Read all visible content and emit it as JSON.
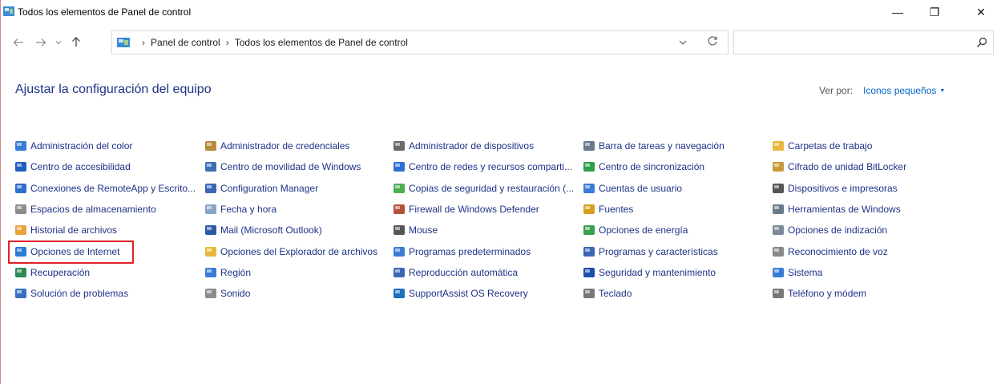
{
  "window": {
    "title": "Todos los elementos de Panel de control",
    "minimize_glyph": "—",
    "maximize_glyph": "❐",
    "close_glyph": "✕"
  },
  "address": {
    "crumbs": [
      "Panel de control",
      "Todos los elementos de Panel de control"
    ],
    "separator": "›"
  },
  "search": {
    "placeholder": "",
    "value": ""
  },
  "header": {
    "title": "Ajustar la configuración del equipo",
    "view_by_label": "Ver por:",
    "view_by_value": "Iconos pequeños"
  },
  "items": {
    "col1": [
      {
        "label": "Administración del color",
        "icon": "color-management-icon",
        "color": "#3a7bd5"
      },
      {
        "label": "Centro de accesibilidad",
        "icon": "accessibility-icon",
        "color": "#1f5fbf"
      },
      {
        "label": "Conexiones de RemoteApp y Escrito...",
        "icon": "remoteapp-icon",
        "color": "#2f6fd0"
      },
      {
        "label": "Espacios de almacenamiento",
        "icon": "storage-spaces-icon",
        "color": "#8c8c8c"
      },
      {
        "label": "Historial de archivos",
        "icon": "file-history-icon",
        "color": "#e8a33c"
      },
      {
        "label": "Opciones de Internet",
        "icon": "internet-options-icon",
        "color": "#2b7ad6"
      },
      {
        "label": "Recuperación",
        "icon": "recovery-icon",
        "color": "#2e8b57"
      },
      {
        "label": "Solución de problemas",
        "icon": "troubleshooting-icon",
        "color": "#3a6fc0"
      }
    ],
    "col2": [
      {
        "label": "Administrador de credenciales",
        "icon": "credential-manager-icon",
        "color": "#b58a3a"
      },
      {
        "label": "Centro de movilidad de Windows",
        "icon": "mobility-center-icon",
        "color": "#3d6fb5"
      },
      {
        "label": "Configuration Manager",
        "icon": "configuration-manager-icon",
        "color": "#3a66b5"
      },
      {
        "label": "Fecha y hora",
        "icon": "date-time-icon",
        "color": "#8aa4c8"
      },
      {
        "label": "Mail (Microsoft Outlook)",
        "icon": "mail-icon",
        "color": "#2a5aa8"
      },
      {
        "label": "Opciones del Explorador de archivos",
        "icon": "explorer-options-icon",
        "color": "#e8b93c"
      },
      {
        "label": "Región",
        "icon": "region-icon",
        "color": "#3a7bd5"
      },
      {
        "label": "Sonido",
        "icon": "sound-icon",
        "color": "#8c8c8c"
      }
    ],
    "col3": [
      {
        "label": "Administrador de dispositivos",
        "icon": "device-manager-icon",
        "color": "#6a6a6a"
      },
      {
        "label": "Centro de redes y recursos comparti...",
        "icon": "network-center-icon",
        "color": "#2f6fd0"
      },
      {
        "label": "Copias de seguridad y restauración (...",
        "icon": "backup-icon",
        "color": "#4caf50"
      },
      {
        "label": "Firewall de Windows Defender",
        "icon": "firewall-icon",
        "color": "#b5533a"
      },
      {
        "label": "Mouse",
        "icon": "mouse-icon",
        "color": "#555555"
      },
      {
        "label": "Programas predeterminados",
        "icon": "default-programs-icon",
        "color": "#3a7bd5"
      },
      {
        "label": "Reproducción automática",
        "icon": "autoplay-icon",
        "color": "#3a66b5"
      },
      {
        "label": "SupportAssist OS Recovery",
        "icon": "supportassist-icon",
        "color": "#1e6fc0"
      }
    ],
    "col4": [
      {
        "label": "Barra de tareas y navegación",
        "icon": "taskbar-icon",
        "color": "#6a7a8a"
      },
      {
        "label": "Centro de sincronización",
        "icon": "sync-center-icon",
        "color": "#2e9e4a"
      },
      {
        "label": "Cuentas de usuario",
        "icon": "user-accounts-icon",
        "color": "#3a7bd5"
      },
      {
        "label": "Fuentes",
        "icon": "fonts-icon",
        "color": "#d4a21e"
      },
      {
        "label": "Opciones de energía",
        "icon": "power-options-icon",
        "color": "#3aa050"
      },
      {
        "label": "Programas y características",
        "icon": "programs-features-icon",
        "color": "#3a66b5"
      },
      {
        "label": "Seguridad y mantenimiento",
        "icon": "security-maintenance-icon",
        "color": "#1e4fa8"
      },
      {
        "label": "Teclado",
        "icon": "keyboard-icon",
        "color": "#777777"
      }
    ],
    "col5": [
      {
        "label": "Carpetas de trabajo",
        "icon": "work-folders-icon",
        "color": "#e8b93c"
      },
      {
        "label": "Cifrado de unidad BitLocker",
        "icon": "bitlocker-icon",
        "color": "#c99a3a"
      },
      {
        "label": "Dispositivos e impresoras",
        "icon": "devices-printers-icon",
        "color": "#555555"
      },
      {
        "label": "Herramientas de Windows",
        "icon": "windows-tools-icon",
        "color": "#6a7a8a"
      },
      {
        "label": "Opciones de indización",
        "icon": "indexing-options-icon",
        "color": "#7a8a9a"
      },
      {
        "label": "Reconocimiento de voz",
        "icon": "speech-recognition-icon",
        "color": "#888888"
      },
      {
        "label": "Sistema",
        "icon": "system-icon",
        "color": "#3a7bd5"
      },
      {
        "label": "Teléfono y módem",
        "icon": "phone-modem-icon",
        "color": "#777777"
      }
    ]
  }
}
